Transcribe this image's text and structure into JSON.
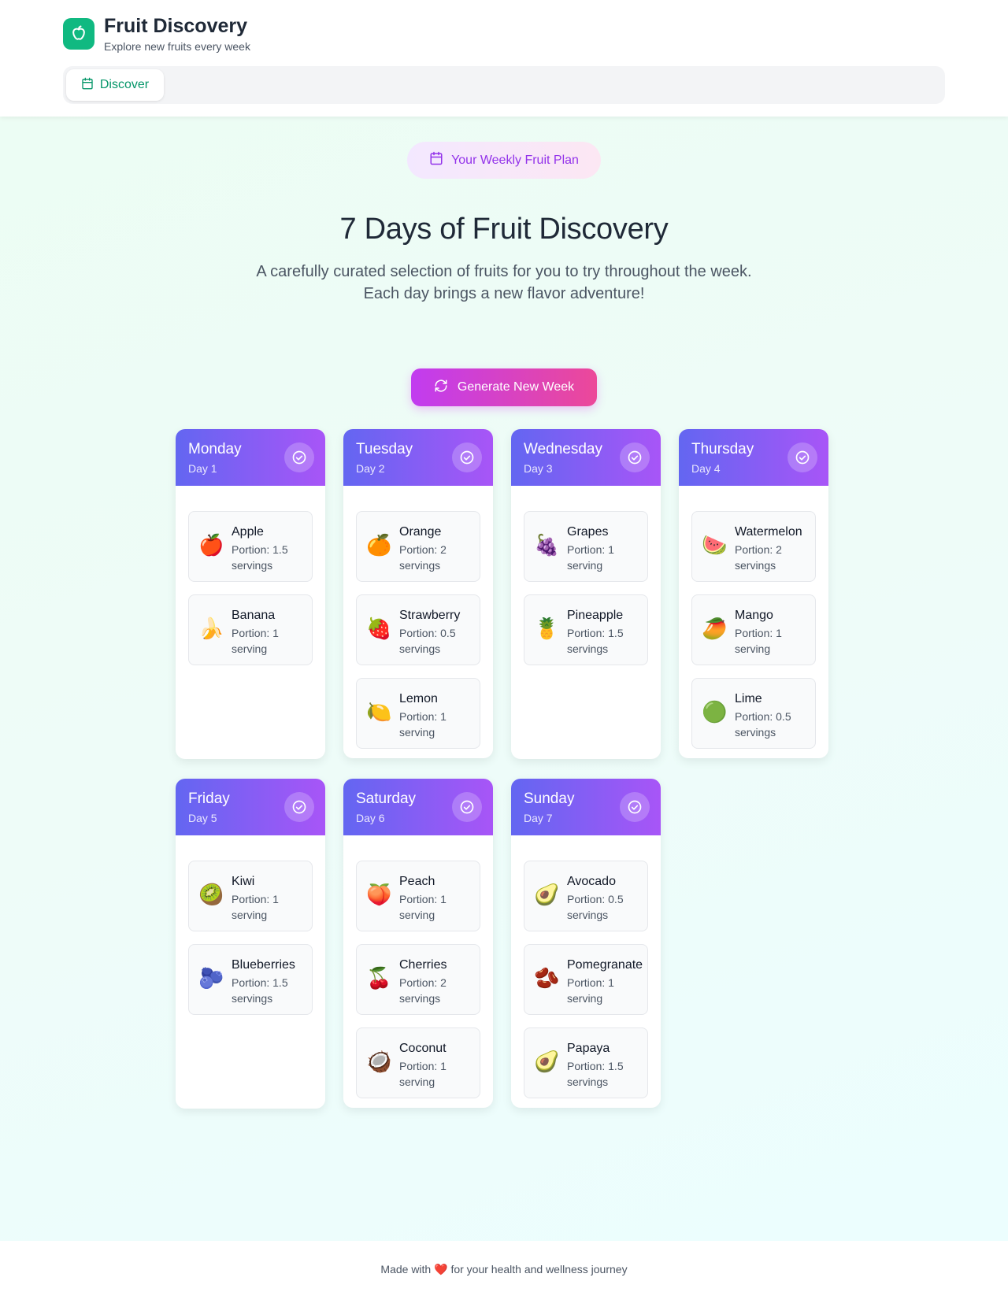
{
  "app": {
    "title": "Fruit Discovery",
    "subtitle": "Explore new fruits every week",
    "logo_icon": "apple-icon",
    "brand_color": "#10b981"
  },
  "nav": {
    "tabs": [
      {
        "label": "Discover",
        "icon": "calendar-icon",
        "active": true
      }
    ]
  },
  "hero": {
    "badge": "Your Weekly Fruit Plan",
    "badge_icon": "calendar-icon",
    "title": "7 Days of Fruit Discovery",
    "description": "A carefully curated selection of fruits for you to try throughout the week. Each day brings a new flavor adventure!",
    "button_label": "Generate New Week",
    "button_icon": "refresh-icon"
  },
  "days": [
    {
      "name": "Monday",
      "label": "Day 1",
      "fruits": [
        {
          "name": "Apple",
          "emoji": "🍎",
          "portion": "Portion: 1.5 servings"
        },
        {
          "name": "Banana",
          "emoji": "🍌",
          "portion": "Portion: 1 serving"
        }
      ]
    },
    {
      "name": "Tuesday",
      "label": "Day 2",
      "fruits": [
        {
          "name": "Orange",
          "emoji": "🍊",
          "portion": "Portion: 2 servings"
        },
        {
          "name": "Strawberry",
          "emoji": "🍓",
          "portion": "Portion: 0.5 servings"
        },
        {
          "name": "Lemon",
          "emoji": "🍋",
          "portion": "Portion: 1 serving"
        }
      ]
    },
    {
      "name": "Wednesday",
      "label": "Day 3",
      "fruits": [
        {
          "name": "Grapes",
          "emoji": "🍇",
          "portion": "Portion: 1 serving"
        },
        {
          "name": "Pineapple",
          "emoji": "🍍",
          "portion": "Portion: 1.5 servings"
        }
      ]
    },
    {
      "name": "Thursday",
      "label": "Day 4",
      "fruits": [
        {
          "name": "Watermelon",
          "emoji": "🍉",
          "portion": "Portion: 2 servings"
        },
        {
          "name": "Mango",
          "emoji": "🥭",
          "portion": "Portion: 1 serving"
        },
        {
          "name": "Lime",
          "emoji": "🟢",
          "portion": "Portion: 0.5 servings"
        }
      ]
    },
    {
      "name": "Friday",
      "label": "Day 5",
      "fruits": [
        {
          "name": "Kiwi",
          "emoji": "🥝",
          "portion": "Portion: 1 serving"
        },
        {
          "name": "Blueberries",
          "emoji": "🫐",
          "portion": "Portion: 1.5 servings"
        }
      ]
    },
    {
      "name": "Saturday",
      "label": "Day 6",
      "fruits": [
        {
          "name": "Peach",
          "emoji": "🍑",
          "portion": "Portion: 1 serving"
        },
        {
          "name": "Cherries",
          "emoji": "🍒",
          "portion": "Portion: 2 servings"
        },
        {
          "name": "Coconut",
          "emoji": "🥥",
          "portion": "Portion: 1 serving"
        }
      ]
    },
    {
      "name": "Sunday",
      "label": "Day 7",
      "fruits": [
        {
          "name": "Avocado",
          "emoji": "🥑",
          "portion": "Portion: 0.5 servings"
        },
        {
          "name": "Pomegranate",
          "emoji": "🫘",
          "portion": "Portion: 1 serving"
        },
        {
          "name": "Papaya",
          "emoji": "🥑",
          "portion": "Portion: 1.5 servings"
        }
      ]
    }
  ],
  "footer": {
    "before": "Made with",
    "heart": "❤️",
    "after": "for your health and wellness journey"
  }
}
